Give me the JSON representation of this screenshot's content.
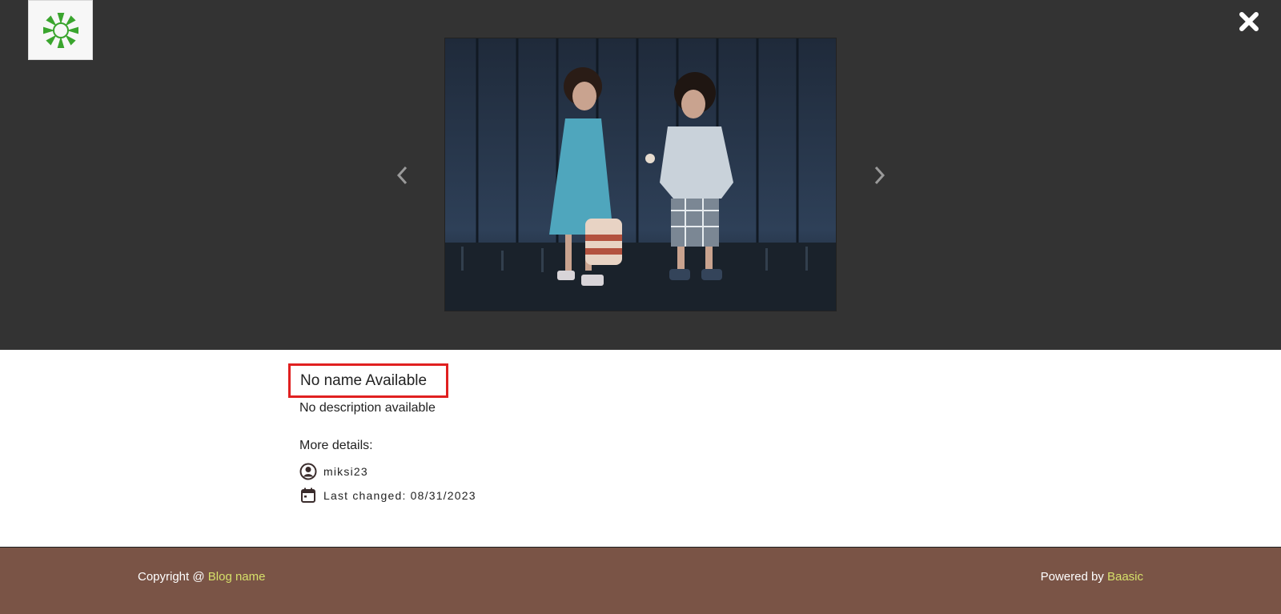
{
  "viewer": {
    "background": "#333333",
    "logo_icon": "sun-flower-icon",
    "close_icon": "close-icon",
    "prev_icon": "chevron-left-icon",
    "next_icon": "chevron-right-icon"
  },
  "photo": {
    "subject": "two-children-photo"
  },
  "item": {
    "title": "No name Available",
    "description": "No description available",
    "more_details_label": "More details:",
    "author": "miksi23",
    "author_icon": "user-circle-icon",
    "last_changed": "Last changed: 08/31/2023",
    "date_icon": "calendar-icon"
  },
  "footer": {
    "copyright_prefix": "Copyright @ ",
    "blog_name": "Blog name",
    "powered_prefix": "Powered by ",
    "powered_name": "Baasic",
    "background": "#7a5446",
    "link_color": "#d6e06a"
  },
  "colors": {
    "highlight": "#e02020",
    "logo_green": "#3aa52e"
  }
}
